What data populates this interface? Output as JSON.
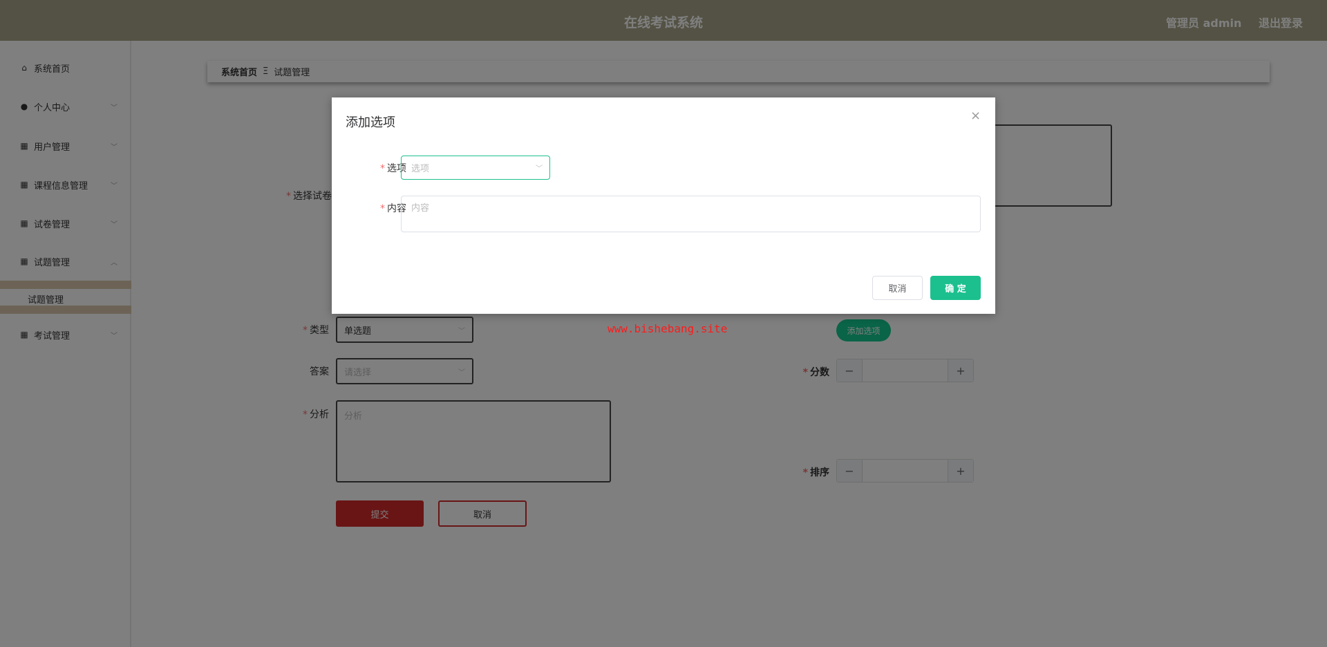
{
  "header": {
    "title": "在线考试系统",
    "user": "管理员 admin",
    "logout": "退出登录"
  },
  "sidebar": {
    "items": [
      {
        "label": "系统首页",
        "icon": "home-icon"
      },
      {
        "label": "个人中心",
        "icon": "user-icon"
      },
      {
        "label": "用户管理",
        "icon": "grid-icon"
      },
      {
        "label": "课程信息管理",
        "icon": "grid-icon"
      },
      {
        "label": "试卷管理",
        "icon": "grid-icon"
      },
      {
        "label": "试题管理",
        "icon": "grid-icon",
        "expanded": true
      },
      {
        "label": "考试管理",
        "icon": "grid-icon"
      }
    ],
    "sub_item": "试题管理"
  },
  "breadcrumb": {
    "home": "系统首页",
    "separator": "Ξ",
    "current": "试题管理"
  },
  "form": {
    "paper_label": "选择试卷",
    "type_label": "类型",
    "type_value": "单选题",
    "answer_label": "答案",
    "answer_placeholder": "请选择",
    "analysis_label": "分析",
    "analysis_placeholder": "分析",
    "add_option": "添加选项",
    "score_label": "分数",
    "order_label": "排序",
    "submit": "提交",
    "cancel": "取消",
    "required": "*"
  },
  "watermark": "www.bishebang.site",
  "dialog": {
    "title": "添加选项",
    "option_label": "选项",
    "option_placeholder": "选项",
    "content_label": "内容",
    "content_placeholder": "内容",
    "cancel": "取消",
    "confirm": "确 定",
    "close": "×"
  },
  "colors": {
    "header": "#a8a488",
    "primary_green": "#1bc08e",
    "danger_red": "#d32b2b"
  }
}
